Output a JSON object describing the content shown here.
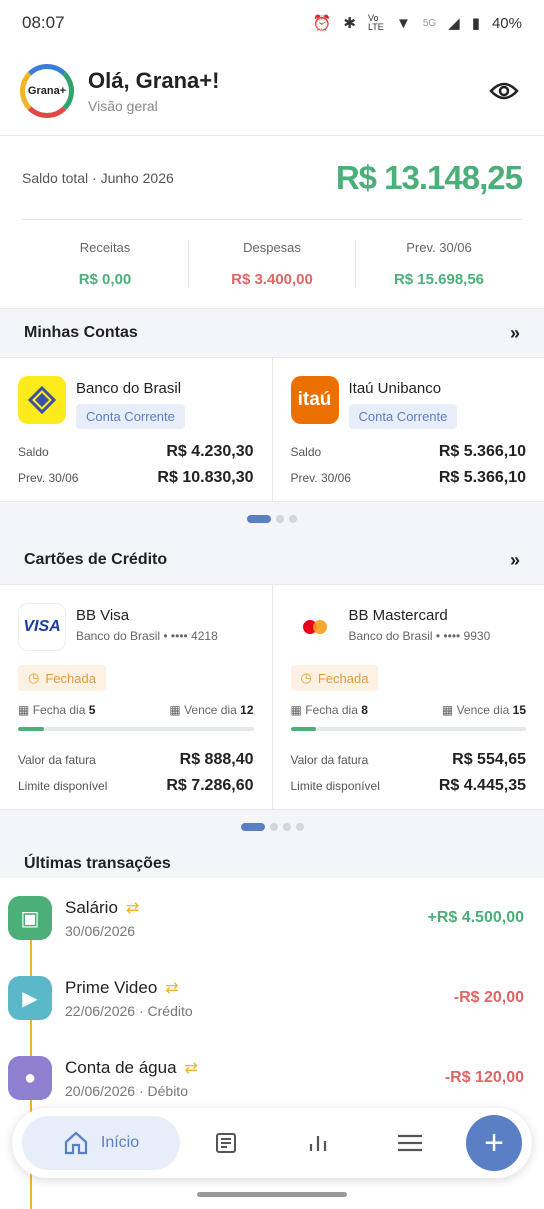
{
  "status": {
    "time": "08:07",
    "network": "5G",
    "battery": "40%",
    "volte": "Vo LTE"
  },
  "header": {
    "logo_text": "Grana+",
    "title": "Olá, Grana+!",
    "subtitle": "Visão geral"
  },
  "balance": {
    "label": "Saldo total · Junho 2026",
    "value": "R$ 13.148,25",
    "income_label": "Receitas",
    "income_value": "R$ 0,00",
    "expense_label": "Despesas",
    "expense_value": "R$ 3.400,00",
    "forecast_label": "Prev. 30/06",
    "forecast_value": "R$ 15.698,56"
  },
  "accounts": {
    "title": "Minhas Contas",
    "items": [
      {
        "name": "Banco do Brasil",
        "type": "Conta Corrente",
        "saldo_label": "Saldo",
        "saldo": "R$ 4.230,30",
        "prev_label": "Prev. 30/06",
        "prev": "R$ 10.830,30",
        "logo_bg": "#fcea1b",
        "logo_fg": "#3b4fa8"
      },
      {
        "name": "Itaú Unibanco",
        "type": "Conta Corrente",
        "saldo_label": "Saldo",
        "saldo": "R$ 5.366,10",
        "prev_label": "Prev. 30/06",
        "prev": "R$ 5.366,10",
        "logo_bg": "#ec7000",
        "logo_fg": "#ffffff",
        "logo_text": "itaú"
      }
    ]
  },
  "cards": {
    "title": "Cartões de Crédito",
    "items": [
      {
        "name": "BB Visa",
        "bank": "Banco do Brasil • •••• 4218",
        "brand_text": "VISA",
        "status": "Fechada",
        "close_label": "Fecha dia",
        "close_day": "5",
        "due_label": "Vence dia",
        "due_day": "12",
        "progress": 0.11,
        "invoice_label": "Valor da fatura",
        "invoice": "R$ 888,40",
        "limit_label": "Limite disponível",
        "limit": "R$ 7.286,60"
      },
      {
        "name": "BB Mastercard",
        "bank": "Banco do Brasil • •••• 9930",
        "status": "Fechada",
        "close_label": "Fecha dia",
        "close_day": "8",
        "due_label": "Vence dia",
        "due_day": "15",
        "progress": 0.11,
        "invoice_label": "Valor da fatura",
        "invoice": "R$ 554,65",
        "limit_label": "Limite disponível",
        "limit": "R$ 4.445,35"
      }
    ]
  },
  "transactions": {
    "title": "Últimas transações",
    "items": [
      {
        "title": "Salário",
        "date": "30/06/2026",
        "amount": "+R$ 4.500,00",
        "color": "#4caf7a",
        "icon": "cash-icon"
      },
      {
        "title": "Prime Video",
        "date": "22/06/2026 · Crédito",
        "amount": "-R$ 20,00",
        "color": "#5ab8c9",
        "icon": "tv-icon"
      },
      {
        "title": "Conta de água",
        "date": "20/06/2026 · Débito",
        "amount": "-R$ 120,00",
        "color": "#8f7fd0",
        "icon": "drop-icon"
      }
    ]
  },
  "nav": {
    "home_label": "Início"
  },
  "colors": {
    "primary": "#5a7fc4",
    "positive": "#4caf7a",
    "negative": "#e06565",
    "warning": "#f0b429"
  }
}
